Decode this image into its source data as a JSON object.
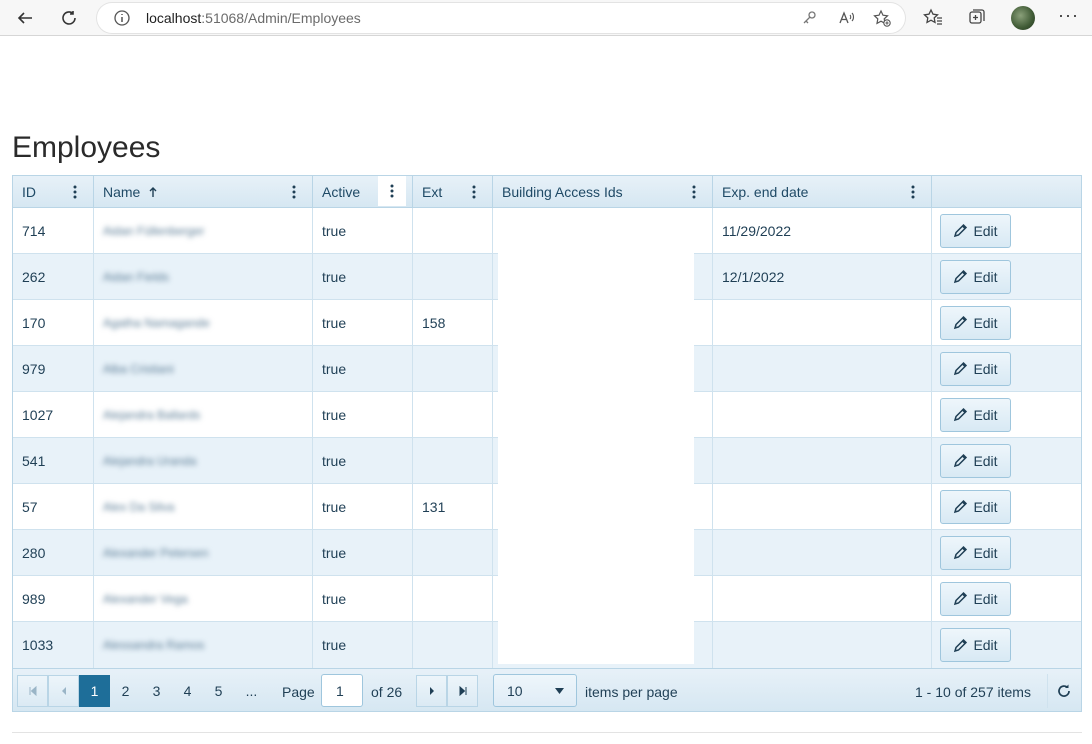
{
  "browser": {
    "url_host": "localhost",
    "url_rest": ":51068/Admin/Employees"
  },
  "page": {
    "title": "Employees"
  },
  "grid": {
    "columns": [
      "ID",
      "Name",
      "Active",
      "Ext",
      "Building Access Ids",
      "Exp. end date",
      ""
    ],
    "rows": [
      {
        "id": "714",
        "name": "Aidan Füllenberger",
        "active": "true",
        "ext": "",
        "access": "",
        "exp": "11/29/2022"
      },
      {
        "id": "262",
        "name": "Aidan Fields",
        "active": "true",
        "ext": "",
        "access": "",
        "exp": "12/1/2022"
      },
      {
        "id": "170",
        "name": "Agatha Namagande",
        "active": "true",
        "ext": "158",
        "access": "",
        "exp": ""
      },
      {
        "id": "979",
        "name": "Alba Cristiani",
        "active": "true",
        "ext": "",
        "access": "",
        "exp": ""
      },
      {
        "id": "1027",
        "name": "Alejandra Ballards",
        "active": "true",
        "ext": "",
        "access": "",
        "exp": ""
      },
      {
        "id": "541",
        "name": "Alejandra Uranda",
        "active": "true",
        "ext": "",
        "access": "",
        "exp": ""
      },
      {
        "id": "57",
        "name": "Alex Da Silva",
        "active": "true",
        "ext": "131",
        "access": "",
        "exp": ""
      },
      {
        "id": "280",
        "name": "Alexander Petersen",
        "active": "true",
        "ext": "",
        "access": "",
        "exp": ""
      },
      {
        "id": "989",
        "name": "Alexander Vega",
        "active": "true",
        "ext": "",
        "access": "",
        "exp": ""
      },
      {
        "id": "1033",
        "name": "Alessandra Ramos",
        "active": "true",
        "ext": "",
        "access": "",
        "exp": ""
      }
    ],
    "edit_label": "Edit"
  },
  "pager": {
    "pages": [
      "1",
      "2",
      "3",
      "4",
      "5",
      "..."
    ],
    "page_label": "Page",
    "current_page": "1",
    "of_label": "of 26",
    "page_size": "10",
    "items_per_page_label": "items per page",
    "summary": "1 - 10 of 257 items"
  },
  "colors": {
    "accent": "#1e6e99",
    "header_bg": "#dbeaf4",
    "border": "#b9d5e6"
  }
}
